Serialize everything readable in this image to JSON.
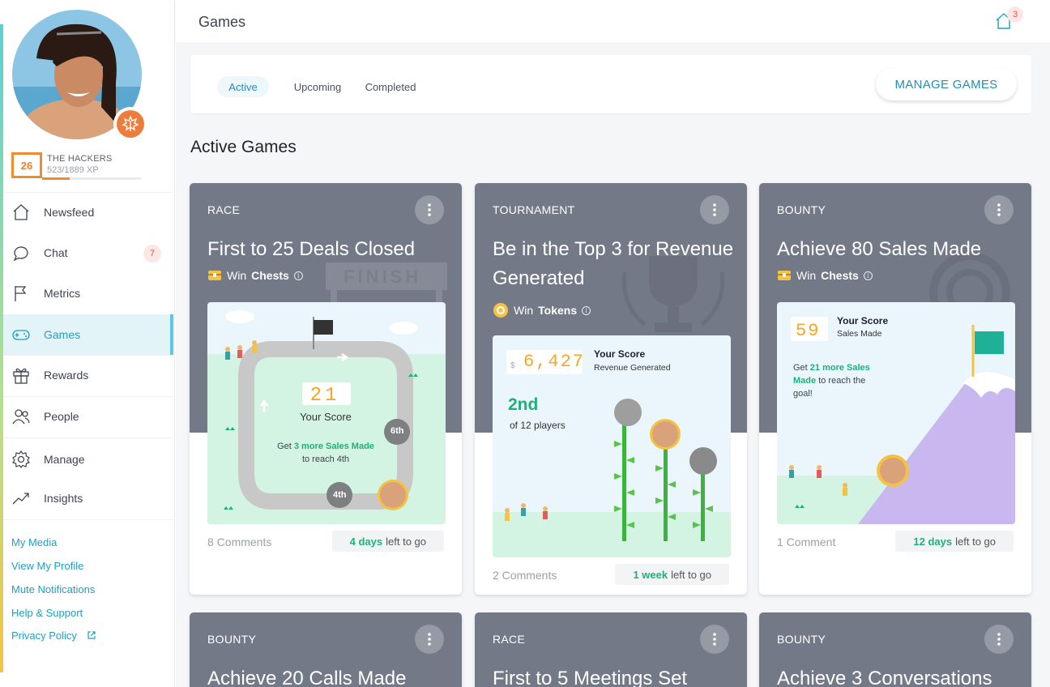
{
  "profile": {
    "level": "26",
    "team": "THE HACKERS",
    "xp": "523/1889 XP",
    "xp_progress": 0.277
  },
  "nav": [
    {
      "label": "Newsfeed",
      "icon": "home-icon"
    },
    {
      "label": "Chat",
      "icon": "chat-icon",
      "badge": "7"
    },
    {
      "label": "Metrics",
      "icon": "flag-icon"
    },
    {
      "label": "Games",
      "icon": "gamepad-icon",
      "active": true
    },
    {
      "label": "Rewards",
      "icon": "gift-icon"
    },
    {
      "label": "People",
      "icon": "people-icon"
    },
    {
      "label": "Manage",
      "icon": "gear-icon"
    },
    {
      "label": "Insights",
      "icon": "trend-icon"
    }
  ],
  "links": [
    "My Media",
    "View My Profile",
    "Mute Notifications",
    "Help & Support",
    "Privacy Policy"
  ],
  "header": {
    "title": "Games",
    "home_badge": "3"
  },
  "tabs": {
    "active": "Active",
    "upcoming": "Upcoming",
    "completed": "Completed",
    "manage": "MANAGE GAMES"
  },
  "section_title": "Active Games",
  "cards": [
    {
      "type": "RACE",
      "title": "First to 25 Deals Closed",
      "prize_prefix": "Win",
      "prize": "Chests",
      "score": "21",
      "score_label": "Your Score",
      "tip_pre": "Get",
      "tip_hi": "3 more Sales Made",
      "tip_post": "to reach 4th",
      "rank_a": "6th",
      "rank_b": "4th",
      "comments": "8 Comments",
      "time_hi": "4 days",
      "time_post": "left to go"
    },
    {
      "type": "TOURNAMENT",
      "title": "Be in the Top 3 for Revenue Generated",
      "prize_prefix": "Win",
      "prize": "Tokens",
      "currency": "$",
      "score": "6,427",
      "score_label": "Your Score",
      "score_sub": "Revenue Generated",
      "place": "2nd",
      "place_sub": "of 12 players",
      "comments": "2 Comments",
      "time_hi": "1 week",
      "time_post": "left to go"
    },
    {
      "type": "BOUNTY",
      "title": "Achieve 80 Sales Made",
      "prize_prefix": "Win",
      "prize": "Chests",
      "score": "59",
      "score_label": "Your Score",
      "score_sub": "Sales Made",
      "tip_pre": "Get",
      "tip_hi": "21 more Sales Made",
      "tip_post": "to reach the goal!",
      "comments": "1 Comment",
      "time_hi": "12 days",
      "time_post": "left to go"
    },
    {
      "type": "BOUNTY",
      "title": "Achieve 20 Calls Made"
    },
    {
      "type": "RACE",
      "title": "First to 5 Meetings Set"
    },
    {
      "type": "BOUNTY",
      "title": "Achieve 3 Conversations"
    }
  ],
  "colors": {
    "accent": "#1f9fc0",
    "card_header": "#737987",
    "green": "#1fb07a",
    "orange": "#f08c2e"
  }
}
